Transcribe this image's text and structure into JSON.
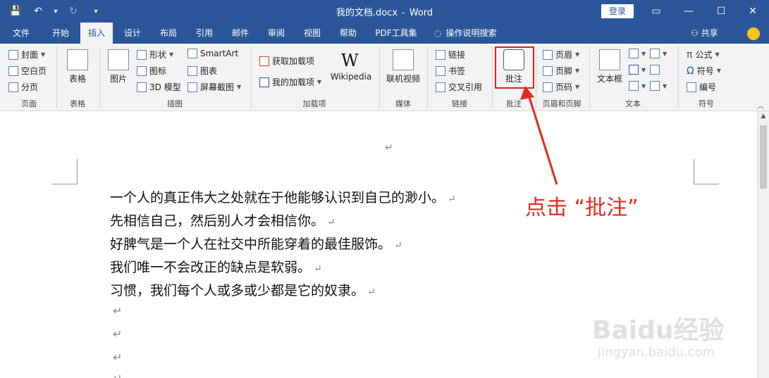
{
  "window": {
    "title_file": "我的文档.docx",
    "title_sep": "-",
    "title_app": "Word",
    "login": "登录",
    "controls": {
      "ribbon_options": "▭",
      "minimize": "—",
      "maximize": "☐",
      "close": "✕"
    }
  },
  "quick_access": {
    "save": "💾",
    "undo": "↶",
    "undo_dd": "▾",
    "redo": "↻",
    "customize": "▾"
  },
  "tabs": [
    {
      "label": "文件"
    },
    {
      "label": "开始"
    },
    {
      "label": "插入"
    },
    {
      "label": "设计"
    },
    {
      "label": "布局"
    },
    {
      "label": "引用"
    },
    {
      "label": "邮件"
    },
    {
      "label": "审阅"
    },
    {
      "label": "视图"
    },
    {
      "label": "帮助"
    },
    {
      "label": "PDF工具集"
    },
    {
      "label": "操作说明搜索"
    }
  ],
  "active_tab": "插入",
  "share": "共享",
  "ribbon": {
    "pages": {
      "cover": "封面",
      "blank": "空白页",
      "break": "分页",
      "label": "页面"
    },
    "tables": {
      "table": "表格",
      "label": "表格"
    },
    "illustrations": {
      "picture": "图片",
      "shapes": "形状",
      "icons": "图标",
      "model3d": "3D 模型",
      "smartart": "SmartArt",
      "chart": "图表",
      "screenshot": "屏幕截图",
      "label": "插图"
    },
    "addins": {
      "get": "获取加载项",
      "mine": "我的加载项",
      "wiki_logo": "W",
      "wikipedia": "Wikipedia",
      "label": "加载项"
    },
    "media": {
      "video": "联机视频",
      "label": "媒体"
    },
    "links": {
      "link": "链接",
      "bookmark": "书签",
      "crossref": "交叉引用",
      "label": "链接"
    },
    "comments": {
      "comment": "批注",
      "label": "批注"
    },
    "header_footer": {
      "header": "页眉",
      "footer": "页脚",
      "page_number": "页码",
      "label": "页眉和页脚"
    },
    "text": {
      "textbox": "文本框",
      "label": "文本"
    },
    "symbols": {
      "equation": "公式",
      "symbol": "符号",
      "numbering": "编号",
      "label": "符号"
    }
  },
  "document": {
    "top_mark": "↵",
    "lines": [
      "一个人的真正伟大之处就在于他能够认识到自己的渺小。",
      "先相信自己，然后别人才会相信你。",
      "好脾气是一个人在社交中所能穿着的最佳服饰。",
      "我们唯一不会改正的缺点是软弱。",
      "习惯，我们每个人或多或少都是它的奴隶。"
    ],
    "para_mark": "↵"
  },
  "annotation": "点击 “批注”",
  "watermark": {
    "brand": "Baidu经验",
    "url": "jingyan.baidu.com"
  }
}
